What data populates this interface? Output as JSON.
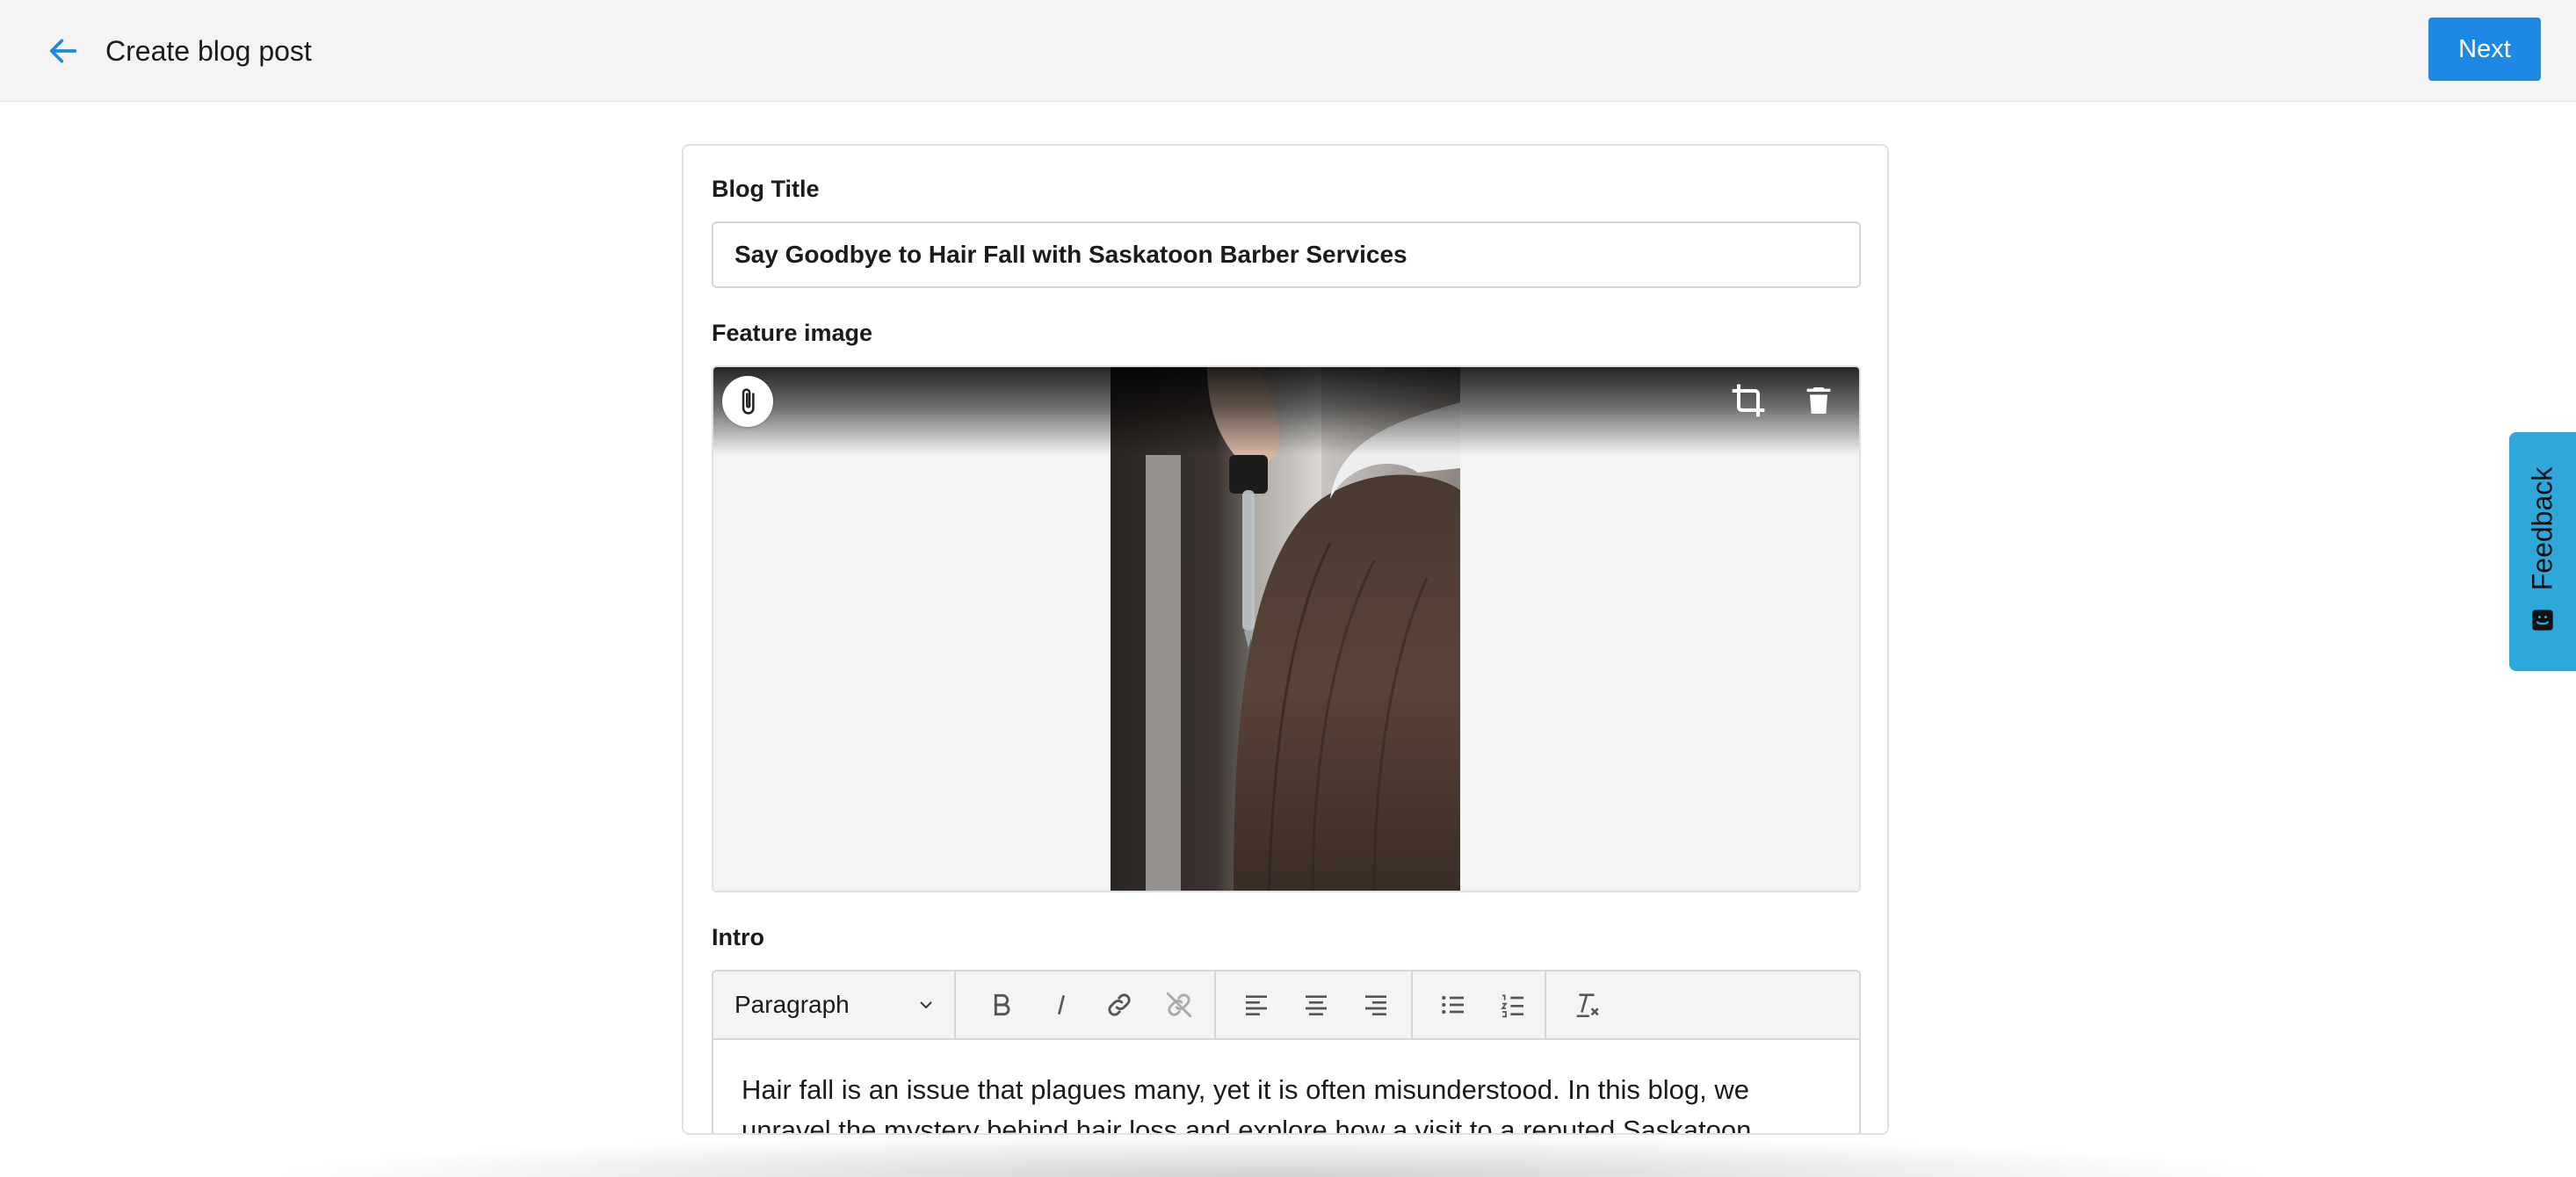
{
  "header": {
    "title": "Create blog post",
    "back_icon": "arrow-left-icon",
    "next_label": "Next"
  },
  "form": {
    "blog_title_label": "Blog Title",
    "blog_title_value": "Say Goodbye to Hair Fall with Saskatoon Barber Services",
    "feature_image_label": "Feature image",
    "feature_image_icons": [
      "paperclip-icon",
      "crop-icon",
      "trash-icon"
    ],
    "intro_label": "Intro",
    "intro_text": "Hair fall is an issue that plagues many, yet it is often misunderstood. In this blog, we unravel the mystery behind hair loss and explore how a visit to a reputed Saskatoon"
  },
  "toolbar": {
    "block_format": "Paragraph",
    "buttons": [
      "bold-icon",
      "italic-icon",
      "link-icon",
      "unlink-icon",
      "align-left-icon",
      "align-center-icon",
      "align-right-icon",
      "bullet-list-icon",
      "numbered-list-icon",
      "clear-formatting-icon"
    ]
  },
  "feedback": {
    "label": "Feedback"
  },
  "colors": {
    "accent": "#1e88e5",
    "header_bg": "#f4f4f4",
    "feedback_bg": "#2ea7db"
  }
}
